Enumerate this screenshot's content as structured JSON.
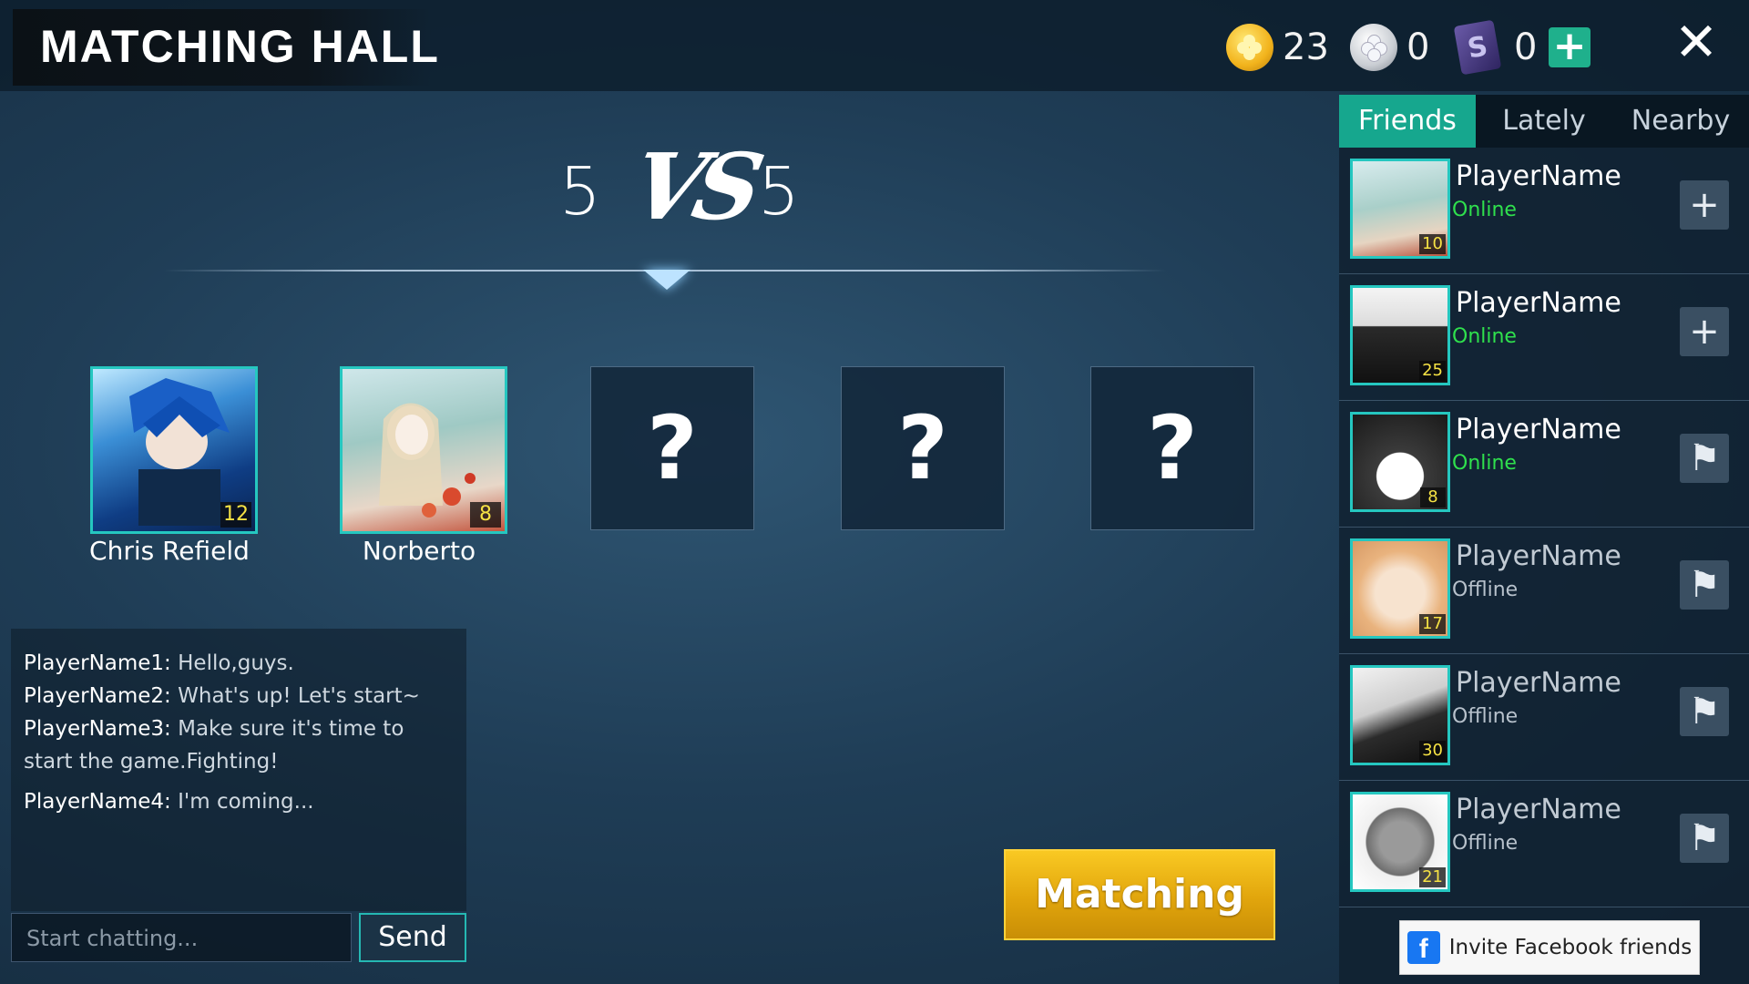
{
  "header": {
    "title": "MATCHING HALL"
  },
  "currency": {
    "gold": "23",
    "silver": "0",
    "cards": "0",
    "card_symbol": "S"
  },
  "icons": {
    "add": "+",
    "close": "✕"
  },
  "match": {
    "left_score": "5",
    "vs": "VS",
    "right_score": "5"
  },
  "team": [
    {
      "name": "Chris Refield",
      "level": "12",
      "avatar": "blue-haired-anime-boy"
    },
    {
      "name": "Norberto",
      "level": "8",
      "avatar": "anime-girl-blossoms"
    },
    {
      "placeholder": "?"
    },
    {
      "placeholder": "?"
    },
    {
      "placeholder": "?"
    }
  ],
  "chat": {
    "messages": [
      {
        "sender": "PlayerName1:",
        "text": " Hello,guys."
      },
      {
        "sender": "PlayerName2:",
        "text": " What's up! Let's start~"
      },
      {
        "sender": "PlayerName3:",
        "text": "  Make sure it's time to start the game.Fighting!"
      },
      {
        "sender": "PlayerName4:",
        "text": " I'm coming..."
      }
    ],
    "placeholder": "Start chatting...",
    "send_label": "Send"
  },
  "matching_button": "Matching",
  "friends_panel": {
    "tabs": [
      "Friends",
      "Lately",
      "Nearby"
    ],
    "active_tab": "Friends",
    "friends": [
      {
        "name": "PlayerName",
        "status": "Online",
        "level": "10",
        "action": "+",
        "action_icon": "add-friend-icon"
      },
      {
        "name": "PlayerName",
        "status": "Online",
        "level": "25",
        "action": "+",
        "action_icon": "add-friend-icon"
      },
      {
        "name": "PlayerName",
        "status": "Online",
        "level": "8",
        "action": "⚑",
        "action_icon": "invite-flag-icon"
      },
      {
        "name": "PlayerName",
        "status": "Offline",
        "level": "17",
        "action": "⚑",
        "action_icon": "invite-flag-icon"
      },
      {
        "name": "PlayerName",
        "status": "Offline",
        "level": "30",
        "action": "⚑",
        "action_icon": "invite-flag-icon"
      },
      {
        "name": "PlayerName",
        "status": "Offline",
        "level": "21",
        "action": "⚑",
        "action_icon": "invite-flag-icon"
      }
    ],
    "invite_label": "Invite Facebook friends",
    "facebook_letter": "f"
  },
  "colors": {
    "accent_teal": "#16a78e",
    "gold_button": "#e1a50c",
    "online_green": "#2fe04d",
    "level_yellow": "#f6e244"
  }
}
